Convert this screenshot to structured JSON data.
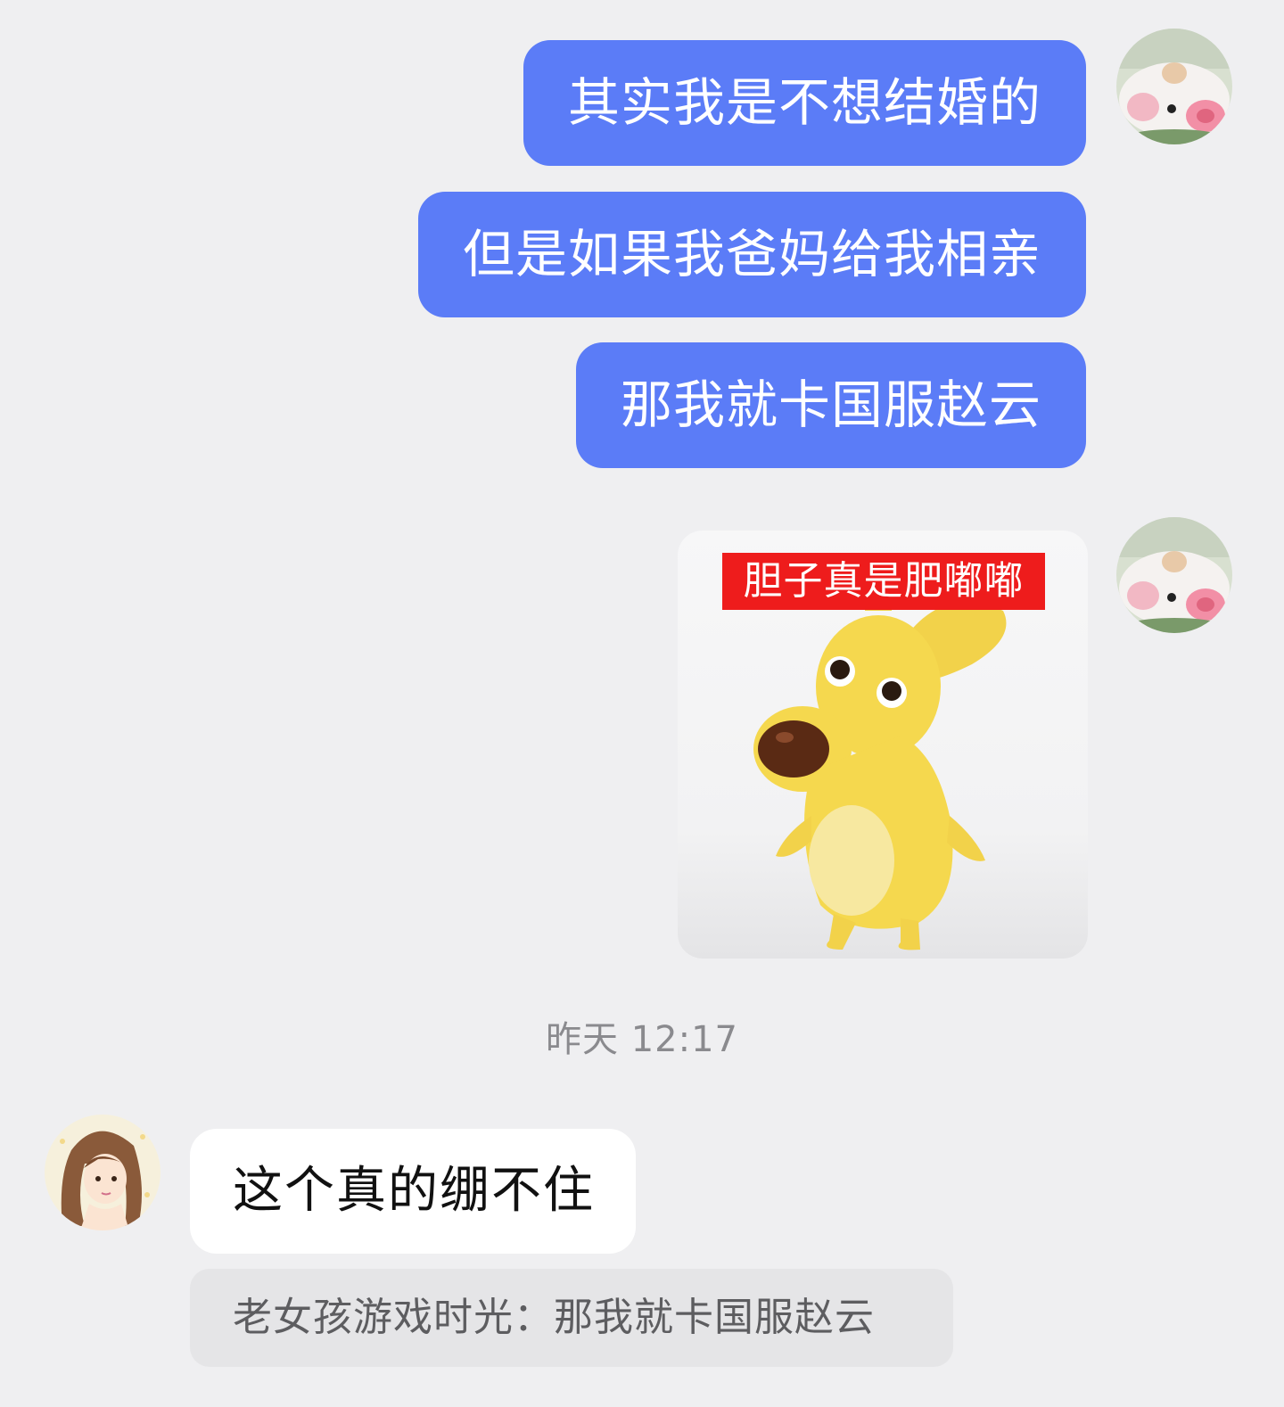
{
  "colors": {
    "background": "#efeff1",
    "outgoing_bubble": "#5b7cf7",
    "incoming_bubble": "#ffffff",
    "quote_bubble": "#e5e5e7",
    "sticker_caption_bg": "#ee1c1c"
  },
  "chat": {
    "outgoing": [
      {
        "text": "其实我是不想结婚的"
      },
      {
        "text": "但是如果我爸妈给我相亲"
      },
      {
        "text": "那我就卡国服赵云"
      }
    ],
    "sticker": {
      "caption": "胆子真是肥嘟嘟",
      "icon": "yellow-dog-sticker-icon"
    },
    "timestamp": "昨天 12:17",
    "incoming": {
      "text": "这个真的绷不住"
    },
    "quote": {
      "text": "老女孩游戏时光：那我就卡国服赵云"
    }
  },
  "avatars": {
    "self": "pig-plush-avatar-icon",
    "other": "anime-girl-avatar-icon"
  }
}
